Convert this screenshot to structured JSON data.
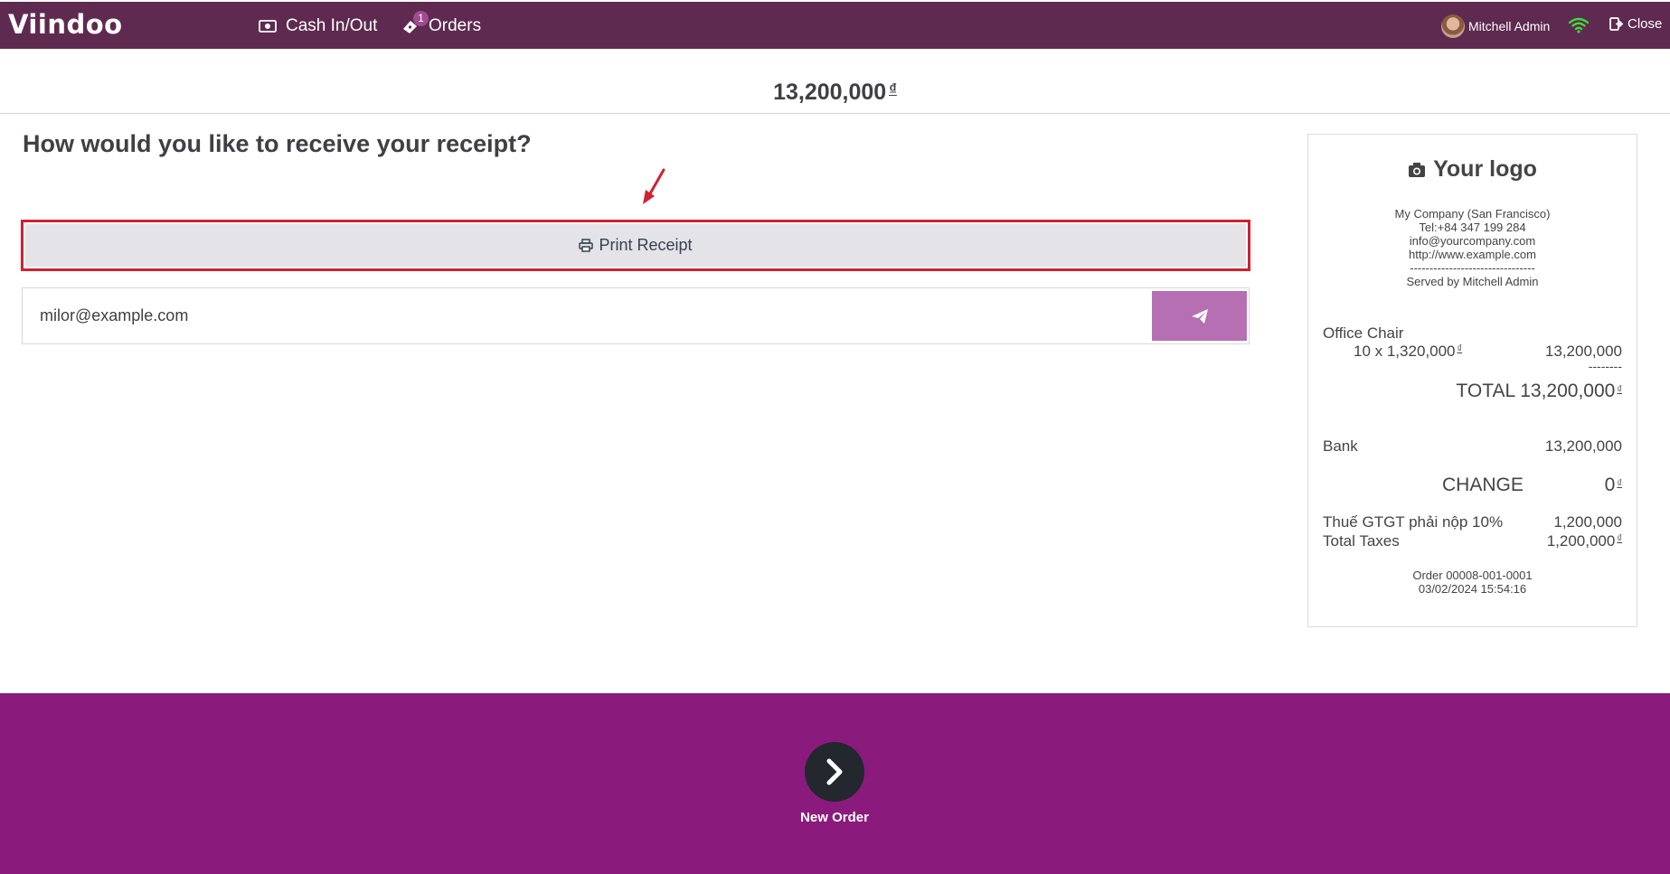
{
  "brand": {
    "name": "Viindoo"
  },
  "nav": {
    "cash_label": "Cash In/Out",
    "orders_label": "Orders",
    "orders_badge": "1"
  },
  "user": {
    "name": "Mitchell Admin"
  },
  "close_label": "Close",
  "order_total": {
    "amount": "13,200,000",
    "currency": "₫"
  },
  "receipt_prompt": {
    "question": "How would you like to receive your receipt?",
    "print_label": "Print Receipt",
    "email_value": "milor@example.com"
  },
  "receipt": {
    "logo_text": "Your logo",
    "company": "My Company (San Francisco)",
    "tel": "Tel:+84 347 199 284",
    "email": "info@yourcompany.com",
    "website": "http://www.example.com",
    "dashes": "--------------------------------",
    "served_by": "Served by Mitchell Admin",
    "line_product": "Office Chair",
    "line_qty_price": "10 x 1,320,000",
    "line_currency": "₫",
    "line_total": "13,200,000",
    "line_sep": "--------",
    "total_label": "TOTAL",
    "total_amount": "13,200,000",
    "total_currency": "₫",
    "payment_method": "Bank",
    "payment_amount": "13,200,000",
    "change_label": "CHANGE",
    "change_amount": "0",
    "change_currency": "₫",
    "tax_label": "Thuế GTGT phải nộp 10%",
    "tax_amount": "1,200,000",
    "total_taxes_label": "Total Taxes",
    "total_taxes_amount": "1,200,000",
    "total_taxes_currency": "₫",
    "order_ref": "Order 00008-001-0001",
    "order_date": "03/02/2024 15:54:16"
  },
  "footer": {
    "new_order_label": "New Order"
  },
  "colors": {
    "topbar": "#5e2a4f",
    "bottom": "#8b1a7d",
    "send_button": "#b66fb2",
    "highlight": "#d22030"
  }
}
